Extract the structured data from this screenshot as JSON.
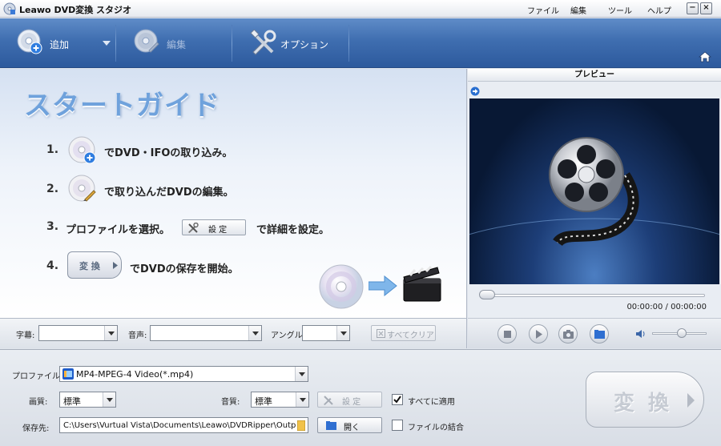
{
  "window": {
    "title": "Leawo DVD変換 スタジオ",
    "minimize": "−",
    "close": "×"
  },
  "menu": [
    "ファイル",
    "編集",
    "ツール",
    "ヘルプ"
  ],
  "toolbar": {
    "add_label": "追加",
    "edit_label": "編集",
    "options_label": "オプション"
  },
  "guide": {
    "title": "スタートガイド",
    "steps": [
      {
        "num": "1.",
        "text": "でDVD・IFOの取り込み。"
      },
      {
        "num": "2.",
        "text": "で取り込んだDVDの編集。"
      },
      {
        "num": "3.",
        "text": "プロファイルを選択。",
        "text2": "で詳細を設定。"
      },
      {
        "num": "4.",
        "text": "でDVDの保存を開始。"
      }
    ],
    "settings_button": "設 定",
    "convert_button": "変 換"
  },
  "preview": {
    "title": "プレビュー",
    "time": "00:00:00 / 00:00:00",
    "progress": 0,
    "volume": 0.55
  },
  "strip": {
    "subtitle_label": "字幕:",
    "subtitle_value": "",
    "audio_label": "音声:",
    "audio_value": "",
    "angle_label": "アングル:",
    "angle_value": "",
    "clear_all": "すべてクリア"
  },
  "settings": {
    "profile_label": "プロファイル:",
    "profile_value": "MP4-MPEG-4 Video(*.mp4)",
    "video_quality_label": "画質:",
    "video_quality_value": "標準",
    "audio_quality_label": "音質:",
    "audio_quality_value": "標準",
    "settings_button": "設 定",
    "apply_all_label": "すべてに適用",
    "apply_all_checked": true,
    "output_label": "保存先:",
    "output_value": "C:\\Users\\Vurtual Vista\\Documents\\Leawo\\DVDRipper\\Outpu",
    "open_button": "開く",
    "merge_label": "ファイルの結合",
    "merge_checked": false,
    "convert_button": "変 換"
  },
  "colors": {
    "toolbar": "#3f6eb0",
    "guide_title": "#6fa2dc",
    "screen": "#1d3e78"
  }
}
